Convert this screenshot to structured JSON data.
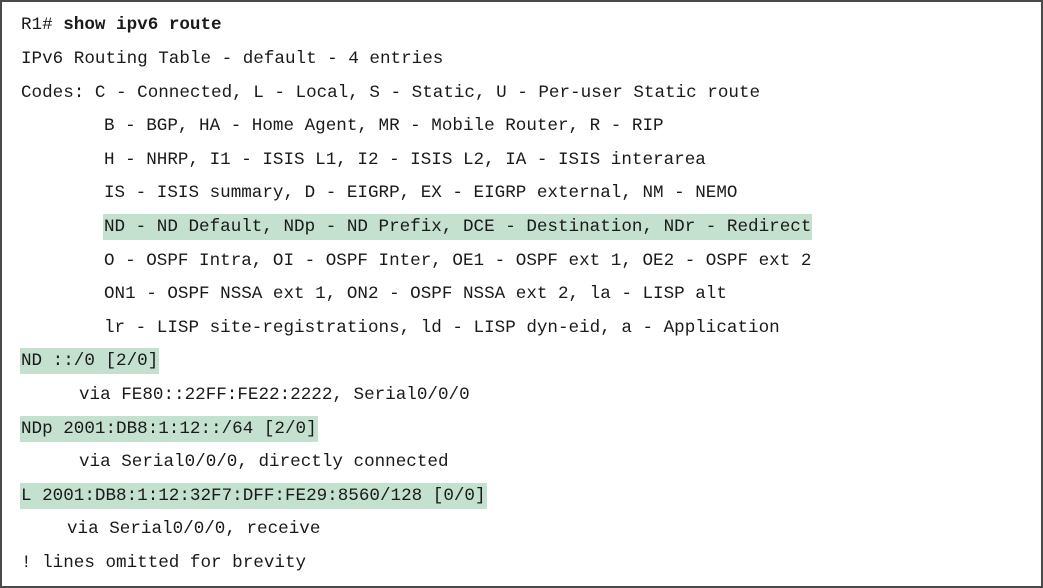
{
  "terminal": {
    "prompt": "R1# ",
    "command": "show ipv6 route",
    "header": "IPv6 Routing Table - default - 4 entries",
    "codes": [
      "Codes: C - Connected, L - Local, S - Static, U - Per-user Static route",
      "B - BGP, HA - Home Agent, MR - Mobile Router, R - RIP",
      "H - NHRP, I1 - ISIS L1, I2 - ISIS L2, IA - ISIS interarea",
      "IS - ISIS summary, D - EIGRP, EX - EIGRP external, NM - NEMO",
      "ND - ND Default, NDp - ND Prefix, DCE - Destination, NDr - Redirect",
      "O - OSPF Intra, OI - OSPF Inter, OE1 - OSPF ext 1, OE2 - OSPF ext 2",
      "ON1 - OSPF NSSA ext 1, ON2 - OSPF NSSA ext 2, la - LISP alt",
      "lr - LISP site-registrations, ld - LISP dyn-eid, a - Application"
    ],
    "routes": [
      {
        "entry": "ND ::/0 [2/0]",
        "via": "via FE80::22FF:FE22:2222, Serial0/0/0"
      },
      {
        "entry": "NDp 2001:DB8:1:12::/64 [2/0]",
        "via": "via Serial0/0/0, directly connected"
      },
      {
        "entry": "L 2001:DB8:1:12:32F7:DFF:FE29:8560/128 [0/0]",
        "via": "via Serial0/0/0, receive"
      }
    ],
    "footer": "! lines omitted for brevity",
    "highlight_color": "#c4e0cf"
  }
}
